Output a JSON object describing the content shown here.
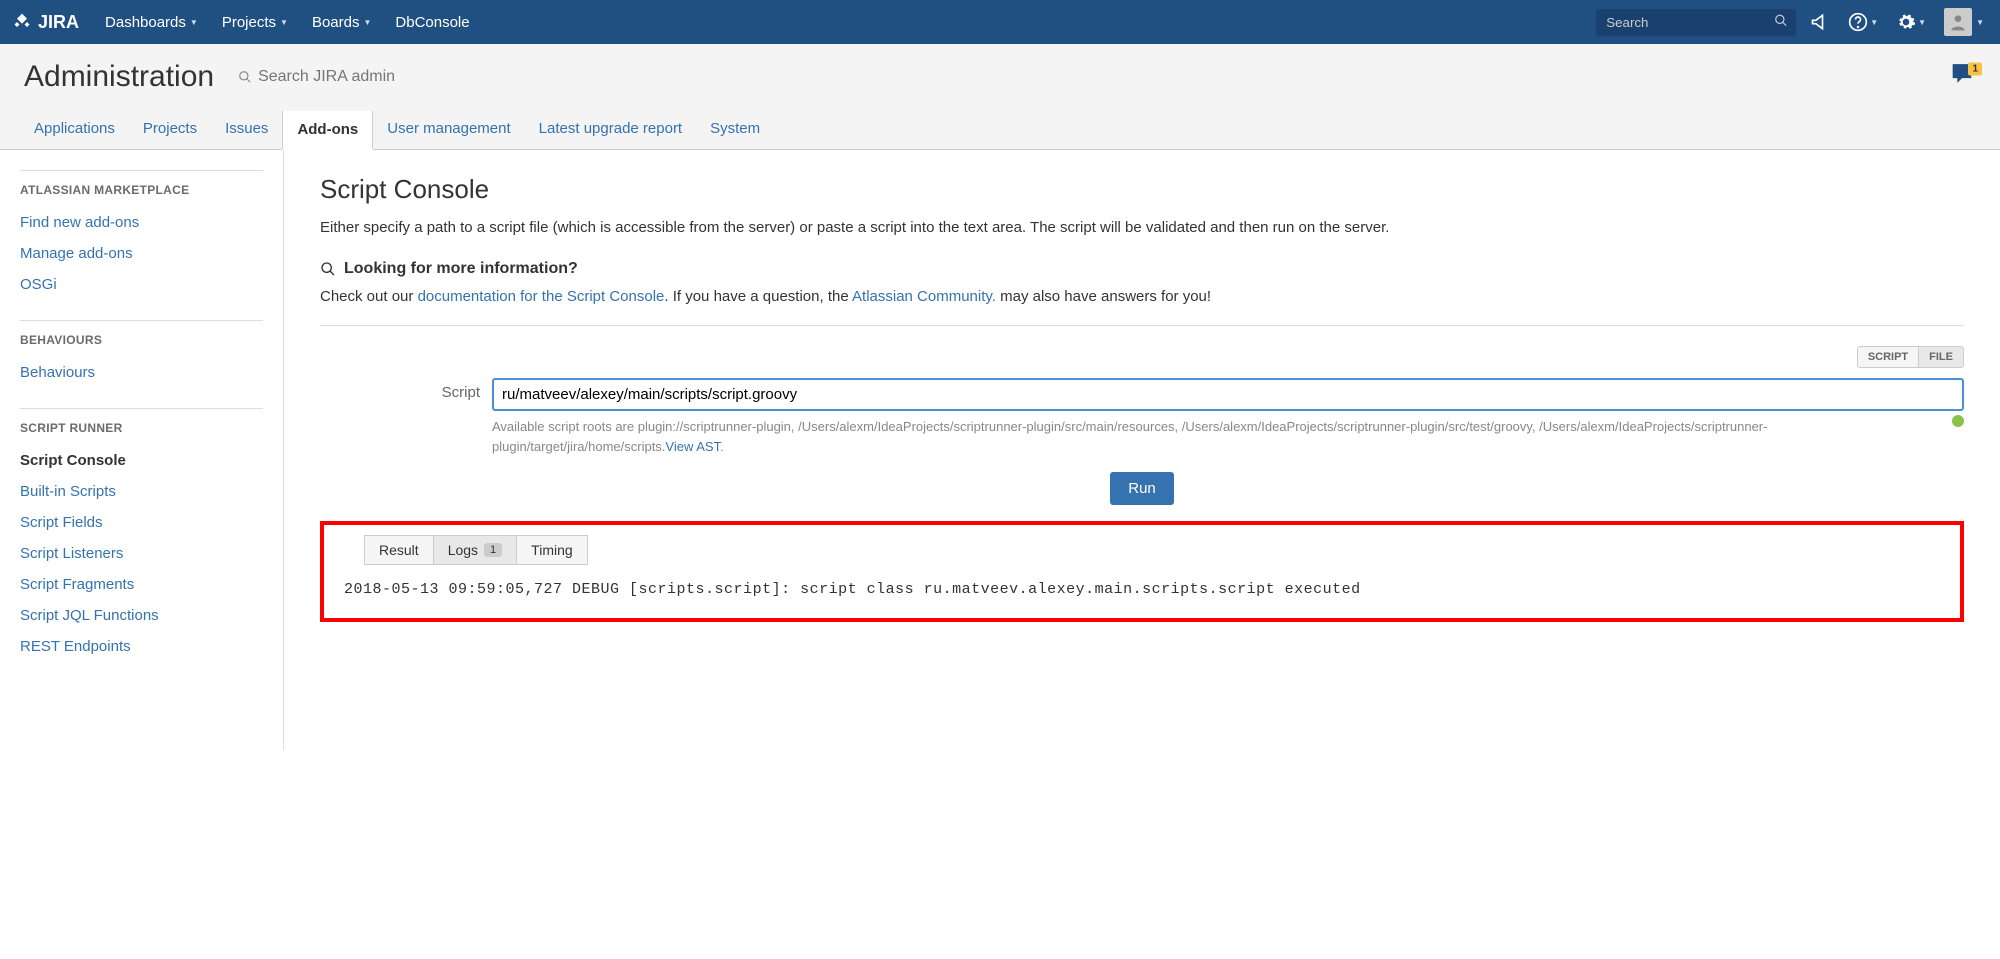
{
  "topnav": {
    "items": [
      "Dashboards",
      "Projects",
      "Boards"
    ],
    "plain_item": "DbConsole",
    "search_placeholder": "Search"
  },
  "admin": {
    "title": "Administration",
    "search_placeholder": "Search JIRA admin",
    "feedback_count": "1",
    "tabs": [
      "Applications",
      "Projects",
      "Issues",
      "Add-ons",
      "User management",
      "Latest upgrade report",
      "System"
    ],
    "active_tab": 3
  },
  "sidebar": {
    "sections": [
      {
        "heading": "ATLASSIAN MARKETPLACE",
        "items": [
          "Find new add-ons",
          "Manage add-ons",
          "OSGi"
        ],
        "active": -1
      },
      {
        "heading": "BEHAVIOURS",
        "items": [
          "Behaviours"
        ],
        "active": -1
      },
      {
        "heading": "SCRIPT RUNNER",
        "items": [
          "Script Console",
          "Built-in Scripts",
          "Script Fields",
          "Script Listeners",
          "Script Fragments",
          "Script JQL Functions",
          "REST Endpoints"
        ],
        "active": 0
      }
    ]
  },
  "page": {
    "title": "Script Console",
    "desc": "Either specify a path to a script file (which is accessible from the server) or paste a script into the text area. The script will be validated and then run on the server.",
    "info_heading": "Looking for more information?",
    "info_prefix": "Check out our ",
    "info_link1": "documentation for the Script Console",
    "info_mid": ". If you have a question, the ",
    "info_link2": "Atlassian Community.",
    "info_suffix": " may also have answers for you!"
  },
  "form": {
    "toggle": [
      "SCRIPT",
      "FILE"
    ],
    "toggle_active": 1,
    "label": "Script",
    "value": "ru/matveev/alexey/main/scripts/script.groovy",
    "hint_prefix": "Available script roots are plugin://scriptrunner-plugin, /Users/alexm/IdeaProjects/scriptrunner-plugin/src/main/resources, /Users/alexm/IdeaProjects/scriptrunner-plugin/src/test/groovy, /Users/alexm/IdeaProjects/scriptrunner-plugin/target/jira/home/scripts.",
    "hint_link": "View AST",
    "hint_suffix": ".",
    "run": "Run"
  },
  "output": {
    "tabs": [
      {
        "label": "Result",
        "badge": ""
      },
      {
        "label": "Logs",
        "badge": "1"
      },
      {
        "label": "Timing",
        "badge": ""
      }
    ],
    "active_tab": 1,
    "log": "2018-05-13 09:59:05,727 DEBUG [scripts.script]: script class ru.matveev.alexey.main.scripts.script executed"
  }
}
